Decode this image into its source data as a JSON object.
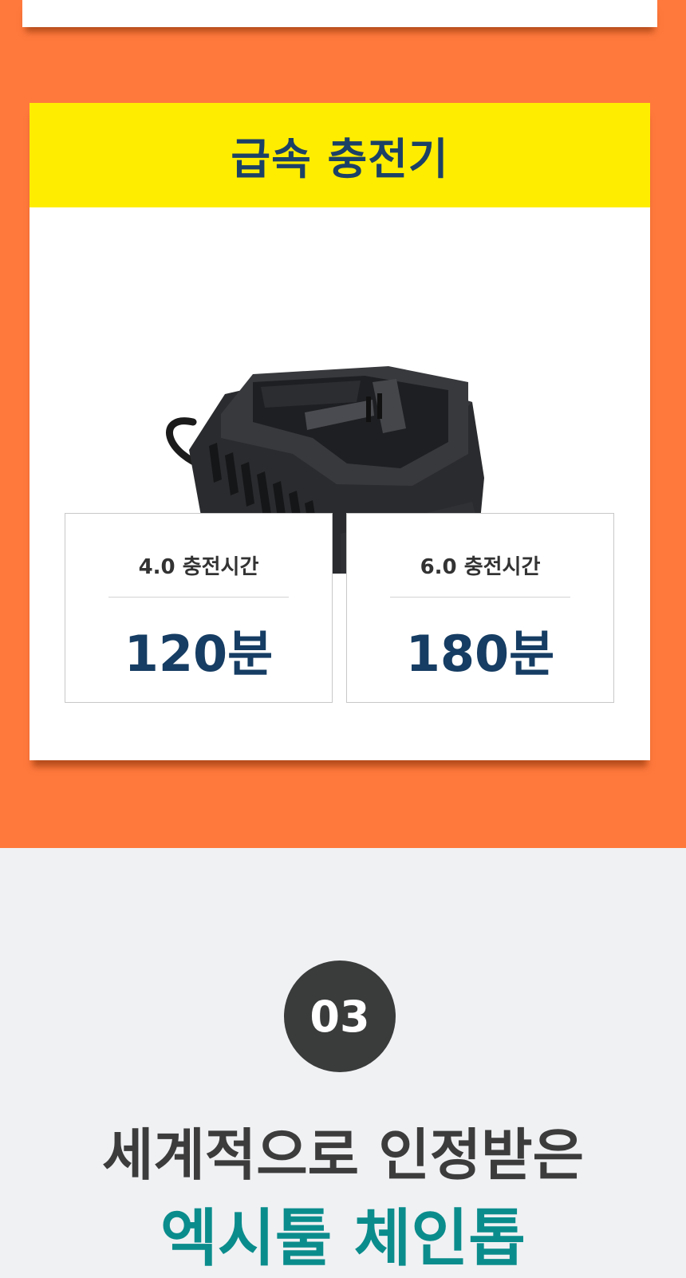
{
  "charger_section": {
    "title": "급속 충전기",
    "product_image": "fast-charger-photo",
    "specs": [
      {
        "label": "4.0 충전시간",
        "value": "120분"
      },
      {
        "label": "6.0 충전시간",
        "value": "180분"
      }
    ]
  },
  "feature_section": {
    "step_number": "03",
    "headline_line1": "세계적으로 인정받은",
    "headline_line2": "엑시툴 체인톱"
  },
  "colors": {
    "orange_background": "#ff793c",
    "header_yellow": "#ffed00",
    "title_navy": "#1c4166",
    "value_navy": "#163d63",
    "headline_teal": "#0b8c8c",
    "badge_dark": "#3a3b3b",
    "page_gray": "#f0f1f3"
  }
}
